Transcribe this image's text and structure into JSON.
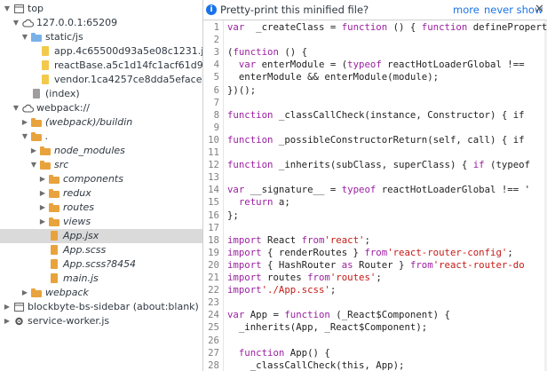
{
  "tree": [
    {
      "label": "top",
      "icon": "frame-icon",
      "arrow": "▼",
      "indent": 0,
      "italic": false,
      "selected": false,
      "name": "tree-item-top"
    },
    {
      "label": "127.0.0.1:65209",
      "icon": "cloud-icon",
      "arrow": "▼",
      "indent": 1,
      "italic": false,
      "selected": false,
      "name": "tree-item-origin"
    },
    {
      "label": "static/js",
      "icon": "folder-blue-icon",
      "arrow": "▼",
      "indent": 2,
      "italic": false,
      "selected": false,
      "name": "tree-item-static-js"
    },
    {
      "label": "app.4c65500d93a5e08c1231.js",
      "icon": "file-yellow-icon",
      "arrow": "",
      "indent": 3,
      "italic": false,
      "selected": false,
      "name": "tree-item-app-bundle"
    },
    {
      "label": "reactBase.a5c1d14fc1acf61d98e",
      "icon": "file-yellow-icon",
      "arrow": "",
      "indent": 3,
      "italic": false,
      "selected": false,
      "name": "tree-item-reactbase-bundle"
    },
    {
      "label": "vendor.1ca4257ce8dda5eface9.",
      "icon": "file-yellow-icon",
      "arrow": "",
      "indent": 3,
      "italic": false,
      "selected": false,
      "name": "tree-item-vendor-bundle"
    },
    {
      "label": "(index)",
      "icon": "file-gray-icon",
      "arrow": "",
      "indent": 2,
      "italic": false,
      "selected": false,
      "name": "tree-item-index"
    },
    {
      "label": "webpack://",
      "icon": "cloud-icon",
      "arrow": "▼",
      "indent": 1,
      "italic": false,
      "selected": false,
      "name": "tree-item-webpack"
    },
    {
      "label": "(webpack)/buildin",
      "icon": "folder-orange-icon",
      "arrow": "▶",
      "indent": 2,
      "italic": true,
      "selected": false,
      "name": "tree-item-webpack-buildin"
    },
    {
      "label": ".",
      "icon": "folder-orange-icon",
      "arrow": "▼",
      "indent": 2,
      "italic": true,
      "selected": false,
      "name": "tree-item-dot"
    },
    {
      "label": "node_modules",
      "icon": "folder-orange-icon",
      "arrow": "▶",
      "indent": 3,
      "italic": true,
      "selected": false,
      "name": "tree-item-node-modules"
    },
    {
      "label": "src",
      "icon": "folder-orange-icon",
      "arrow": "▼",
      "indent": 3,
      "italic": true,
      "selected": false,
      "name": "tree-item-src"
    },
    {
      "label": "components",
      "icon": "folder-orange-icon",
      "arrow": "▶",
      "indent": 4,
      "italic": true,
      "selected": false,
      "name": "tree-item-components"
    },
    {
      "label": "redux",
      "icon": "folder-orange-icon",
      "arrow": "▶",
      "indent": 4,
      "italic": true,
      "selected": false,
      "name": "tree-item-redux"
    },
    {
      "label": "routes",
      "icon": "folder-orange-icon",
      "arrow": "▶",
      "indent": 4,
      "italic": true,
      "selected": false,
      "name": "tree-item-routes"
    },
    {
      "label": "views",
      "icon": "folder-orange-icon",
      "arrow": "▶",
      "indent": 4,
      "italic": true,
      "selected": false,
      "name": "tree-item-views"
    },
    {
      "label": "App.jsx",
      "icon": "file-orange-icon",
      "arrow": "",
      "indent": 4,
      "italic": true,
      "selected": true,
      "name": "tree-item-app-jsx"
    },
    {
      "label": "App.scss",
      "icon": "file-orange-icon",
      "arrow": "",
      "indent": 4,
      "italic": true,
      "selected": false,
      "name": "tree-item-app-scss"
    },
    {
      "label": "App.scss?8454",
      "icon": "file-orange-icon",
      "arrow": "",
      "indent": 4,
      "italic": true,
      "selected": false,
      "name": "tree-item-app-scss-8454"
    },
    {
      "label": "main.js",
      "icon": "file-orange-icon",
      "arrow": "",
      "indent": 4,
      "italic": true,
      "selected": false,
      "name": "tree-item-main-js"
    },
    {
      "label": "webpack",
      "icon": "folder-orange-icon",
      "arrow": "▶",
      "indent": 2,
      "italic": true,
      "selected": false,
      "name": "tree-item-webpack-folder"
    },
    {
      "label": "blockbyte-bs-sidebar (about:blank)",
      "icon": "frame-icon",
      "arrow": "▶",
      "indent": 0,
      "italic": false,
      "selected": false,
      "name": "tree-item-blockbyte-frame"
    },
    {
      "label": "service-worker.js",
      "icon": "gear-icon",
      "arrow": "▶",
      "indent": 0,
      "italic": false,
      "selected": false,
      "name": "tree-item-service-worker"
    }
  ],
  "infobar": {
    "icon": "info-icon",
    "message": "Pretty-print this minified file?",
    "more_link": "more",
    "never_link": "never show",
    "close": "✕"
  },
  "colors": {
    "folder_blue": "#7ab0e8",
    "folder_orange": "#e8a33d",
    "file_yellow": "#f2c94c",
    "file_gray": "#9e9e9e",
    "link": "#1a73e8",
    "keyword": "#9b1fa0",
    "string": "#c41a16",
    "selection": "#dadada"
  },
  "code_lines": [
    {
      "n": "1",
      "segs": [
        [
          "k",
          "var"
        ],
        [
          "",
          "  _createClass = "
        ],
        [
          "k",
          "function"
        ],
        [
          "",
          " () { "
        ],
        [
          "k",
          "function"
        ],
        [
          "",
          " defineProperties"
        ]
      ]
    },
    {
      "n": "2",
      "segs": []
    },
    {
      "n": "3",
      "segs": [
        [
          "",
          "("
        ],
        [
          "k",
          "function"
        ],
        [
          "",
          " () {"
        ]
      ]
    },
    {
      "n": "4",
      "segs": [
        [
          "",
          "  "
        ],
        [
          "k",
          "var"
        ],
        [
          "",
          " enterModule = ("
        ],
        [
          "k",
          "typeof"
        ],
        [
          "",
          " reactHotLoaderGlobal !=="
        ]
      ]
    },
    {
      "n": "5",
      "segs": [
        [
          "",
          "  enterModule && enterModule(module);"
        ]
      ]
    },
    {
      "n": "6",
      "segs": [
        [
          "",
          "})();"
        ]
      ]
    },
    {
      "n": "7",
      "segs": []
    },
    {
      "n": "8",
      "segs": [
        [
          "k",
          "function"
        ],
        [
          "",
          " _classCallCheck(instance, Constructor) { if"
        ]
      ]
    },
    {
      "n": "9",
      "segs": []
    },
    {
      "n": "10",
      "segs": [
        [
          "k",
          "function"
        ],
        [
          "",
          " _possibleConstructorReturn(self, call) { if"
        ]
      ]
    },
    {
      "n": "11",
      "segs": []
    },
    {
      "n": "12",
      "segs": [
        [
          "k",
          "function"
        ],
        [
          "",
          " _inherits(subClass, superClass) { "
        ],
        [
          "k",
          "if"
        ],
        [
          "",
          " (typeof"
        ]
      ]
    },
    {
      "n": "13",
      "segs": []
    },
    {
      "n": "14",
      "segs": [
        [
          "k",
          "var"
        ],
        [
          "",
          " __signature__ = "
        ],
        [
          "k",
          "typeof"
        ],
        [
          "",
          " reactHotLoaderGlobal !== '"
        ]
      ]
    },
    {
      "n": "15",
      "segs": [
        [
          "",
          "  "
        ],
        [
          "k",
          "return"
        ],
        [
          "",
          " a;"
        ]
      ]
    },
    {
      "n": "16",
      "segs": [
        [
          "",
          "};"
        ]
      ]
    },
    {
      "n": "17",
      "segs": []
    },
    {
      "n": "18",
      "segs": [
        [
          "k",
          "import"
        ],
        [
          "",
          " React "
        ],
        [
          "k",
          "from"
        ],
        [
          " ",
          ""
        ],
        [
          "s",
          "'react'"
        ],
        [
          "",
          ";"
        ]
      ]
    },
    {
      "n": "19",
      "segs": [
        [
          "k",
          "import"
        ],
        [
          "",
          " { renderRoutes } "
        ],
        [
          "k",
          "from"
        ],
        [
          " ",
          ""
        ],
        [
          "s",
          "'react-router-config'"
        ],
        [
          "",
          ";"
        ]
      ]
    },
    {
      "n": "20",
      "segs": [
        [
          "k",
          "import"
        ],
        [
          "",
          " { HashRouter "
        ],
        [
          "k",
          "as"
        ],
        [
          "",
          " Router } "
        ],
        [
          "k",
          "from"
        ],
        [
          " ",
          ""
        ],
        [
          "s",
          "'react-router-do"
        ]
      ]
    },
    {
      "n": "21",
      "segs": [
        [
          "k",
          "import"
        ],
        [
          "",
          " routes "
        ],
        [
          "k",
          "from"
        ],
        [
          " ",
          ""
        ],
        [
          "s",
          "'routes'"
        ],
        [
          "",
          ";"
        ]
      ]
    },
    {
      "n": "22",
      "segs": [
        [
          "k",
          "import"
        ],
        [
          " ",
          ""
        ],
        [
          "s",
          "'./App.scss'"
        ],
        [
          "",
          ";"
        ]
      ]
    },
    {
      "n": "23",
      "segs": []
    },
    {
      "n": "24",
      "segs": [
        [
          "k",
          "var"
        ],
        [
          "",
          " App = "
        ],
        [
          "k",
          "function"
        ],
        [
          "",
          " (_React$Component) {"
        ]
      ]
    },
    {
      "n": "25",
      "segs": [
        [
          "",
          "  _inherits(App, _React$Component);"
        ]
      ]
    },
    {
      "n": "26",
      "segs": []
    },
    {
      "n": "27",
      "segs": [
        [
          "",
          "  "
        ],
        [
          "k",
          "function"
        ],
        [
          "",
          " App() {"
        ]
      ]
    },
    {
      "n": "28",
      "segs": [
        [
          "",
          "    _classCallCheck(this, App);"
        ]
      ]
    }
  ]
}
